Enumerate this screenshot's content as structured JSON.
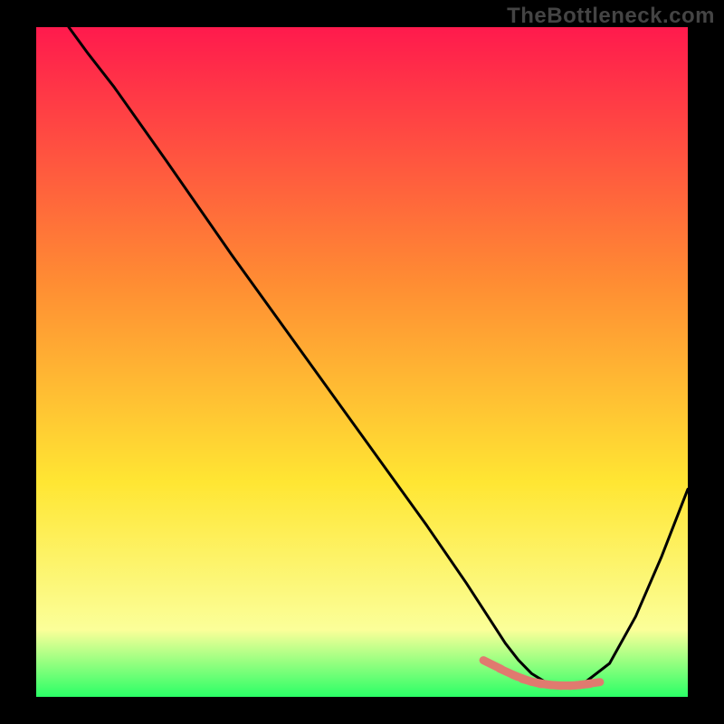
{
  "attribution": "TheBottleneck.com",
  "colors": {
    "frame": "#000000",
    "grad_top": "#ff1a4d",
    "grad_mid1": "#ff8c33",
    "grad_mid2": "#ffe633",
    "grad_low": "#fbff99",
    "grad_bottom": "#2aff66",
    "curve": "#000000",
    "marker_fill": "#e07a6f",
    "marker_stroke": "#c85a50"
  },
  "chart_data": {
    "type": "line",
    "title": "",
    "xlabel": "",
    "ylabel": "",
    "xlim": [
      0,
      100
    ],
    "ylim": [
      0,
      100
    ],
    "x": [
      5,
      8,
      12,
      20,
      30,
      40,
      50,
      60,
      66,
      70,
      72,
      74,
      76,
      78,
      80,
      82,
      84,
      88,
      92,
      96,
      100
    ],
    "values": [
      100,
      96,
      91,
      80,
      66,
      52.5,
      39,
      25.5,
      17,
      11,
      8,
      5.5,
      3.5,
      2.3,
      1.7,
      1.6,
      2.0,
      5,
      12,
      21,
      31
    ],
    "markers": {
      "x": [
        70,
        72.5,
        74.5,
        76,
        77.5,
        79,
        80.5,
        82,
        83.5,
        85
      ],
      "y": [
        4.8,
        3.6,
        2.8,
        2.3,
        2.0,
        1.8,
        1.7,
        1.7,
        1.8,
        2.0
      ]
    }
  }
}
